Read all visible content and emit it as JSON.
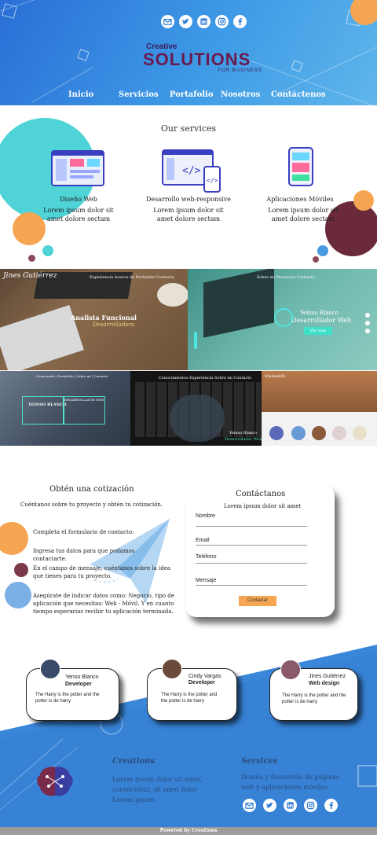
{
  "header": {
    "social_icons": [
      "email-icon",
      "twitter-icon",
      "linkedin-icon",
      "instagram-icon",
      "facebook-icon"
    ],
    "logo": {
      "top": "Creative",
      "main": "SOLUTIONS",
      "sub": "FOR BUSINESS"
    },
    "nav": [
      "Inicio",
      "Servicios",
      "Portafolio",
      "Nosotros",
      "Contáctenos"
    ]
  },
  "services": {
    "title": "Our services",
    "items": [
      {
        "name": "Diseño Web",
        "desc": "Lorem ipsum dolor sit amet dolore sectam"
      },
      {
        "name": "Desarrollo web-responsive",
        "desc": "Lorem ipsum dolor sit amet dolore sectam"
      },
      {
        "name": "Aplicaciones Móviles",
        "desc": "Lorem ipsum dolor sit amet dolore sectam"
      }
    ]
  },
  "portfolio": {
    "tile1": {
      "nav": "Experiencia  Acerca de  Portafolio  Contacto",
      "brand": "Jines Gutiérrez",
      "title": "Analista Funcional",
      "subtitle": "Desarrolladora"
    },
    "tile2": {
      "nav": "Sobre mi    Proyectos    Contacto",
      "name": "Yeinso Blanco",
      "role": "Desarrollador Web",
      "button": "Ver más"
    },
    "tile3": {
      "nav": "Conociendo  |  Portafolio  |  Sobre mi  |  Contacto",
      "name": "YEINSO BLANCO",
      "role": "DESARROLLADOR WEB"
    },
    "tile4": {
      "nav": "Conocimientos  Experiencia  Sobre mi  Contacto",
      "name": "Yeinso Blanco",
      "role": "Desarrollador Web"
    },
    "tile5": {
      "brand": "Studentify"
    }
  },
  "quote": {
    "title": "Obtén una cotización",
    "subtitle": "Cuéntanos sobre tu proyecto y obtén tu cotización.",
    "steps": [
      "Completa  el formulario de contacto:",
      "Ingresa tus datos para que podamos contactarte.",
      "En el campo de mensaje, cuéntanos sobre la idea que tienes para tu proyecto.",
      "Asegúrate de indicar datos como:  Negocio, tipo de aplicación que necesitas: Web - Móvil. Y en cuanto tiempo esperarias recibir tu aplicación terminada."
    ]
  },
  "contact": {
    "title": "Contáctanos",
    "subtitle": "Lorem ipsum dolor sit amet",
    "fields": [
      "Nombre",
      "Email",
      "Teléfono",
      "Mensaje"
    ],
    "button": "Contactar"
  },
  "team": [
    {
      "name": "Yenso Blanco",
      "role": "Developer",
      "quote": "The Harry is the potter and the potter is de harry"
    },
    {
      "name": "Cindy Vargas",
      "role": "Developer",
      "quote": "The Harry is the potter and the potter is de harry"
    },
    {
      "name": "Jines Gutiérrez",
      "role": "Web design",
      "quote": "The Harry is the potter and the potter is de harry"
    }
  ],
  "footer": {
    "creations_title": "Creations",
    "creations_text": "Lorem ipsum dolor sit amet, consectetur, sit amet dolor Lorem ipsum.",
    "services_title": "Services",
    "services_text": "Diseño y desarrollo de páginas web y aplicaciones móviles.",
    "powered": "Powered by Creations"
  },
  "colors": {
    "blue": "#2e7bd6",
    "orange": "#f6a652",
    "teal": "#4fd3d6",
    "maroon": "#6a2a3a"
  }
}
